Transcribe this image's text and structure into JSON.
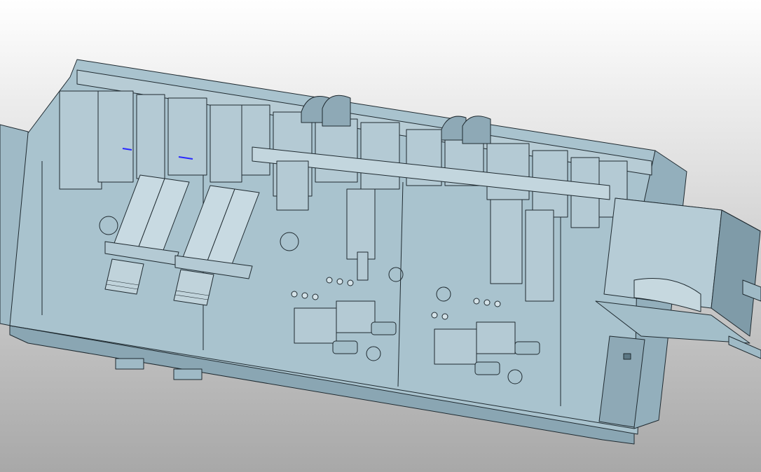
{
  "viewport": {
    "background_top": "#ffffff",
    "background_bottom": "#a8a8a8"
  },
  "model": {
    "body_color": "#9fbac6",
    "face_color": "#a9c3ce",
    "dark_color": "#7f9ba8",
    "edge_color": "#1f2a30",
    "highlight_color": "#2a2aff"
  },
  "labels": {}
}
